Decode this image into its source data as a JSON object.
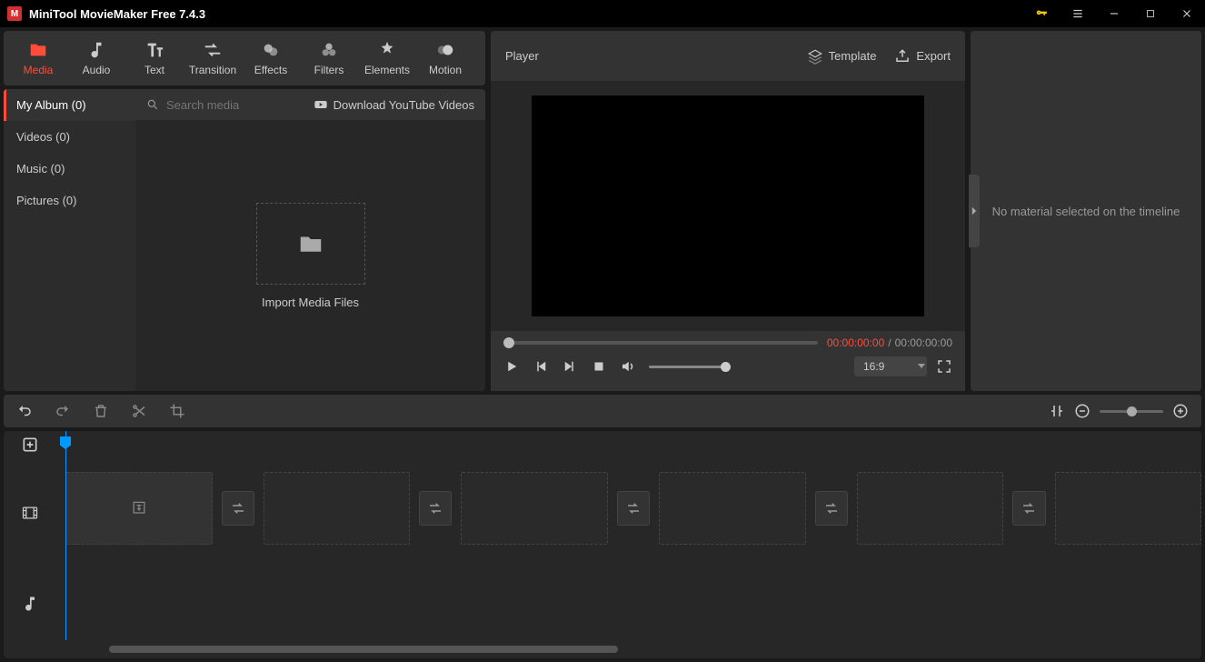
{
  "app": {
    "title": "MiniTool MovieMaker Free 7.4.3"
  },
  "mainTabs": {
    "media": "Media",
    "audio": "Audio",
    "text": "Text",
    "transition": "Transition",
    "effects": "Effects",
    "filters": "Filters",
    "elements": "Elements",
    "motion": "Motion"
  },
  "sidebar": {
    "myAlbum": "My Album (0)",
    "videos": "Videos (0)",
    "music": "Music (0)",
    "pictures": "Pictures (0)"
  },
  "mediaBar": {
    "searchPlaceholder": "Search media",
    "download": "Download YouTube Videos"
  },
  "import": {
    "label": "Import Media Files"
  },
  "player": {
    "title": "Player",
    "template": "Template",
    "export": "Export",
    "timeCurrent": "00:00:00:00",
    "timeSep": " / ",
    "timeTotal": "00:00:00:00",
    "aspect": "16:9"
  },
  "rightPanel": {
    "msg": "No material selected on the timeline"
  }
}
